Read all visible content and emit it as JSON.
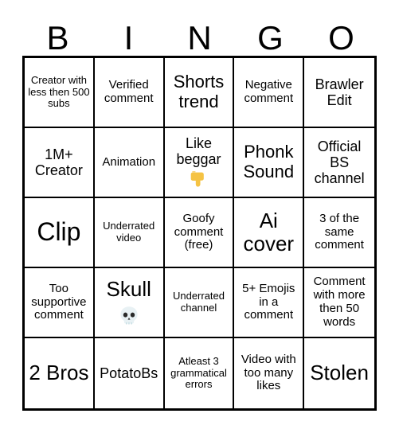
{
  "card": {
    "title": "BINGO",
    "header_letters": [
      "B",
      "I",
      "N",
      "G",
      "O"
    ],
    "rows": [
      [
        {
          "text": "Creator with less then 500 subs",
          "size": "sz-xs",
          "emoji": ""
        },
        {
          "text": "Verified comment",
          "size": "sz-s",
          "emoji": ""
        },
        {
          "text": "Shorts trend",
          "size": "sz-l",
          "emoji": ""
        },
        {
          "text": "Negative comment",
          "size": "sz-s",
          "emoji": ""
        },
        {
          "text": "Brawler Edit",
          "size": "sz-m",
          "emoji": ""
        }
      ],
      [
        {
          "text": "1M+ Creator",
          "size": "sz-m",
          "emoji": ""
        },
        {
          "text": "Animation",
          "size": "sz-s",
          "emoji": ""
        },
        {
          "text": "Like beggar",
          "size": "sz-m",
          "emoji": "backhand-index-pointing-down"
        },
        {
          "text": "Phonk Sound",
          "size": "sz-l",
          "emoji": ""
        },
        {
          "text": "Official BS channel",
          "size": "sz-m",
          "emoji": ""
        }
      ],
      [
        {
          "text": "Clip",
          "size": "sz-xxl",
          "emoji": ""
        },
        {
          "text": "Underrated video",
          "size": "sz-xs",
          "emoji": ""
        },
        {
          "text": "Goofy comment (free)",
          "size": "sz-s",
          "emoji": ""
        },
        {
          "text": "Ai cover",
          "size": "sz-xl",
          "emoji": ""
        },
        {
          "text": "3 of the same comment",
          "size": "sz-s",
          "emoji": ""
        }
      ],
      [
        {
          "text": "Too supportive comment",
          "size": "sz-s",
          "emoji": ""
        },
        {
          "text": "Skull",
          "size": "sz-xl",
          "emoji": "skull"
        },
        {
          "text": "Underrated channel",
          "size": "sz-xs",
          "emoji": ""
        },
        {
          "text": "5+ Emojis in a comment",
          "size": "sz-s",
          "emoji": ""
        },
        {
          "text": "Comment with more then 50 words",
          "size": "sz-s",
          "emoji": ""
        }
      ],
      [
        {
          "text": "2 Bros",
          "size": "sz-xl",
          "emoji": ""
        },
        {
          "text": "PotatoBs",
          "size": "sz-m",
          "emoji": ""
        },
        {
          "text": "Atleast 3 grammatical errors",
          "size": "sz-xs",
          "emoji": ""
        },
        {
          "text": "Video with too many likes",
          "size": "sz-s",
          "emoji": ""
        },
        {
          "text": "Stolen",
          "size": "sz-xl",
          "emoji": ""
        }
      ]
    ],
    "colors": {
      "background": "#ffffff",
      "border": "#000000",
      "text": "#000000",
      "emoji_hand": "#f5c344",
      "emoji_skull": "#e8f1f4"
    }
  }
}
